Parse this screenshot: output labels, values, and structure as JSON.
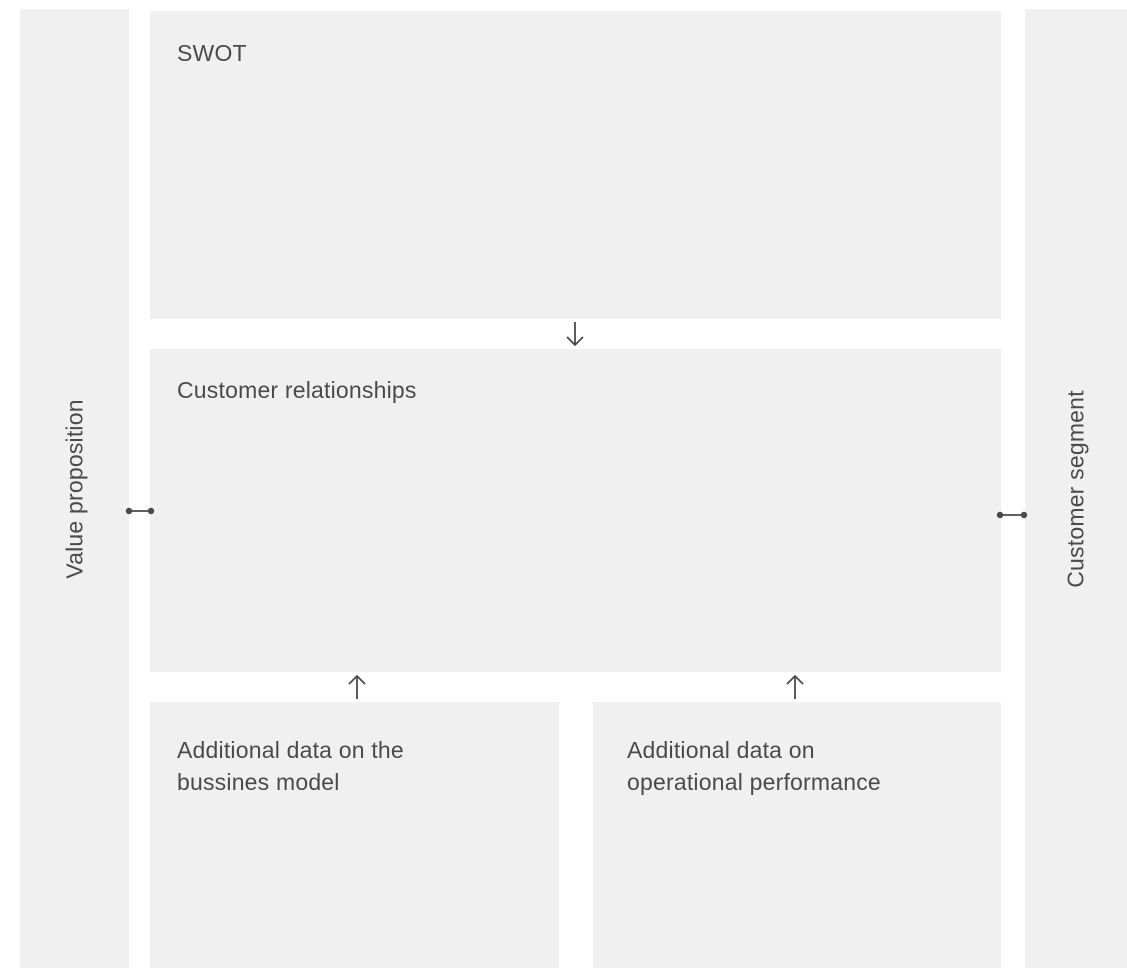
{
  "diagram": {
    "value_proposition": {
      "label": "Value proposition"
    },
    "customer_segment": {
      "label": "Customer segment"
    },
    "swot": {
      "label": "SWOT"
    },
    "customer_relationships": {
      "label": "Customer relationships"
    },
    "business_model_data": {
      "label_line1": "Additional data on the",
      "label_line2": "bussines model"
    },
    "operational_performance_data": {
      "label_line1": "Additional data on",
      "label_line2": "operational performance"
    }
  }
}
